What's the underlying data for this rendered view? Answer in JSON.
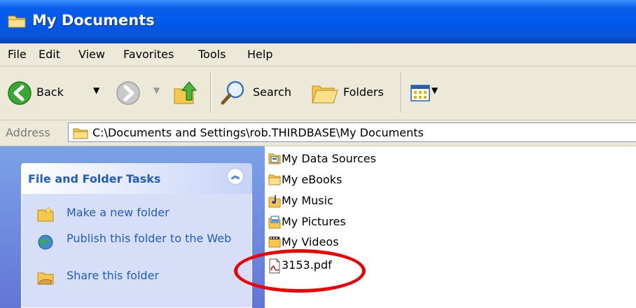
{
  "window": {
    "title": "My Documents"
  },
  "menu": {
    "items": [
      {
        "label": "File"
      },
      {
        "label": "Edit"
      },
      {
        "label": "View"
      },
      {
        "label": "Favorites"
      },
      {
        "label": "Tools"
      },
      {
        "label": "Help"
      }
    ]
  },
  "toolbar": {
    "back_label": "Back",
    "search_label": "Search",
    "folders_label": "Folders"
  },
  "address": {
    "label": "Address",
    "path": "C:\\Documents and Settings\\rob.THIRDBASE\\My Documents"
  },
  "task_pane": {
    "title": "File and Folder Tasks",
    "tasks": [
      {
        "label": "Make a new folder",
        "icon": "new-folder-icon"
      },
      {
        "label": "Publish this folder to the Web",
        "icon": "globe-icon"
      },
      {
        "label": "Share this folder",
        "icon": "share-folder-icon"
      }
    ]
  },
  "files": [
    {
      "name": "My Data Sources",
      "icon": "data-sources-folder-icon"
    },
    {
      "name": "My eBooks",
      "icon": "folder-icon"
    },
    {
      "name": "My Music",
      "icon": "music-folder-icon"
    },
    {
      "name": "My Pictures",
      "icon": "pictures-folder-icon"
    },
    {
      "name": "My Videos",
      "icon": "videos-folder-icon"
    },
    {
      "name": "3153.pdf",
      "icon": "pdf-file-icon"
    }
  ],
  "colors": {
    "titlebar": "#0058ee",
    "chrome": "#ece9d8",
    "task_link": "#215dc6",
    "annotation": "#ee0000"
  }
}
